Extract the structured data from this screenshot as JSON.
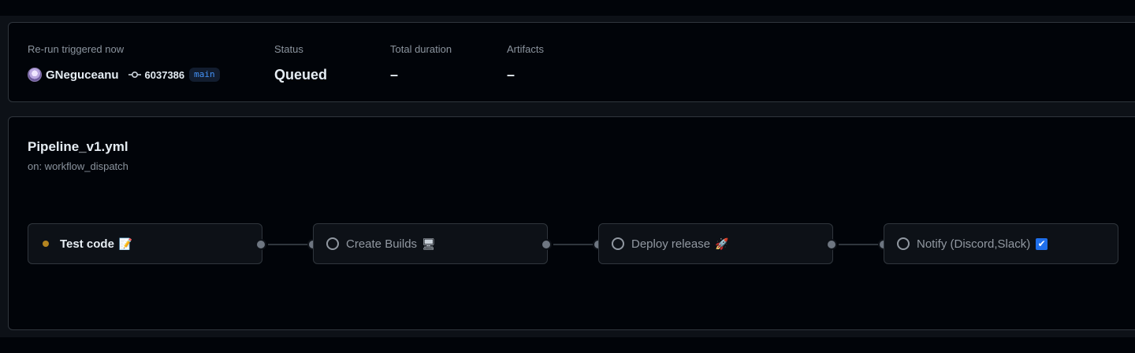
{
  "summary": {
    "trigger_label": "Re-run triggered now",
    "actor": "GNeguceanu",
    "commit_sha": "6037386",
    "branch": "main",
    "status_label": "Status",
    "status_value": "Queued",
    "duration_label": "Total duration",
    "duration_value": "–",
    "artifacts_label": "Artifacts",
    "artifacts_value": "–"
  },
  "workflow": {
    "file": "Pipeline_v1.yml",
    "trigger": "on: workflow_dispatch"
  },
  "jobs": [
    {
      "name": "Test code",
      "emoji": "📝",
      "status": "queued"
    },
    {
      "name": "Create Builds",
      "emoji": "🖥",
      "status": "pending"
    },
    {
      "name": "Deploy release",
      "emoji": "🚀",
      "status": "pending"
    },
    {
      "name": "Notify (Discord,Slack)",
      "emoji": "✔",
      "status": "pending"
    }
  ],
  "colors": {
    "queued": "#d29922",
    "branch": "#4493f8",
    "border": "#30363d"
  }
}
